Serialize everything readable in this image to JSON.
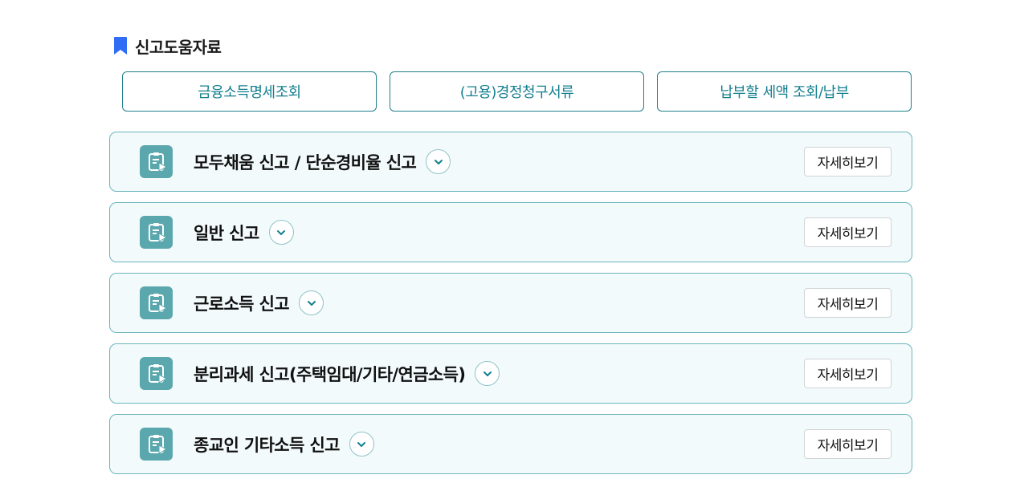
{
  "section": {
    "title": "신고도움자료",
    "icon": "bookmark-icon",
    "icon_color": "#2f6df6"
  },
  "quick_links": [
    {
      "label": "금융소득명세조회"
    },
    {
      "label": "(고용)경정청구서류"
    },
    {
      "label": "납부할 세액 조회/납부"
    }
  ],
  "items": [
    {
      "label": "모두채움 신고 / 단순경비율 신고",
      "detail_label": "자세히보기",
      "icon": "document-play-icon",
      "expand_icon": "chevron-down-icon"
    },
    {
      "label": "일반 신고",
      "detail_label": "자세히보기",
      "icon": "document-play-icon",
      "expand_icon": "chevron-down-icon"
    },
    {
      "label": "근로소득 신고",
      "detail_label": "자세히보기",
      "icon": "document-play-icon",
      "expand_icon": "chevron-down-icon"
    },
    {
      "label": "분리과세 신고(주택임대/기타/연금소득)",
      "detail_label": "자세히보기",
      "icon": "document-play-icon",
      "expand_icon": "chevron-down-icon"
    },
    {
      "label": "종교인 기타소득 신고",
      "detail_label": "자세히보기",
      "icon": "document-play-icon",
      "expand_icon": "chevron-down-icon"
    }
  ],
  "colors": {
    "accent": "#137f8e",
    "item_border": "#6cb5bd",
    "item_background": "#f3fafb",
    "icon_tile": "#5aa7ae"
  }
}
